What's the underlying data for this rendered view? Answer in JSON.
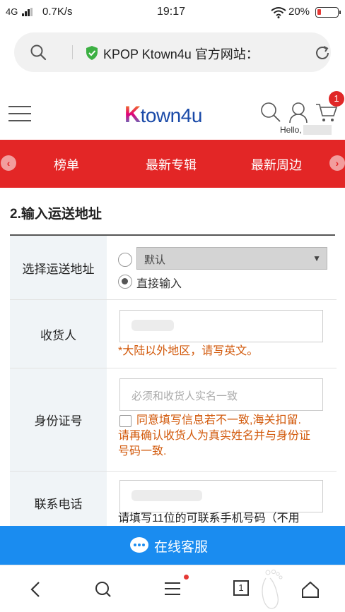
{
  "status": {
    "network": "4G",
    "speed": "0.7K/s",
    "time": "19:17",
    "battery": "20%",
    "battery_level": 0.2
  },
  "browser": {
    "title": "KPOP Ktown4u 官方网站："
  },
  "site": {
    "logo_k": "K",
    "logo_rest": "town4u",
    "hello": "Hello,",
    "cart_count": "1"
  },
  "nav": {
    "left_arrow": "‹",
    "right_arrow": "›",
    "items": [
      "榜单",
      "最新专辑",
      "最新周边"
    ]
  },
  "section": {
    "title": "2.输入运送地址"
  },
  "form": {
    "address_label": "选择运送地址",
    "address_select": "默认",
    "address_direct": "直接输入",
    "recipient_label": "收货人",
    "recipient_note": "*大陆以外地区，请写英文。",
    "id_label": "身份证号",
    "id_placeholder": "必须和收货人实名一致",
    "id_note_line1": "同意填写信息若不一致,海关扣留.",
    "id_note_line2": "请再确认收货人为真实姓名并与身份证",
    "id_note_line3": "号码一致.",
    "phone_label": "联系电话",
    "phone_help": "请填写11位的可联系手机号码（不用"
  },
  "chat": {
    "label": "在线客服"
  },
  "bottom_nav": {
    "tab_count": "1"
  }
}
